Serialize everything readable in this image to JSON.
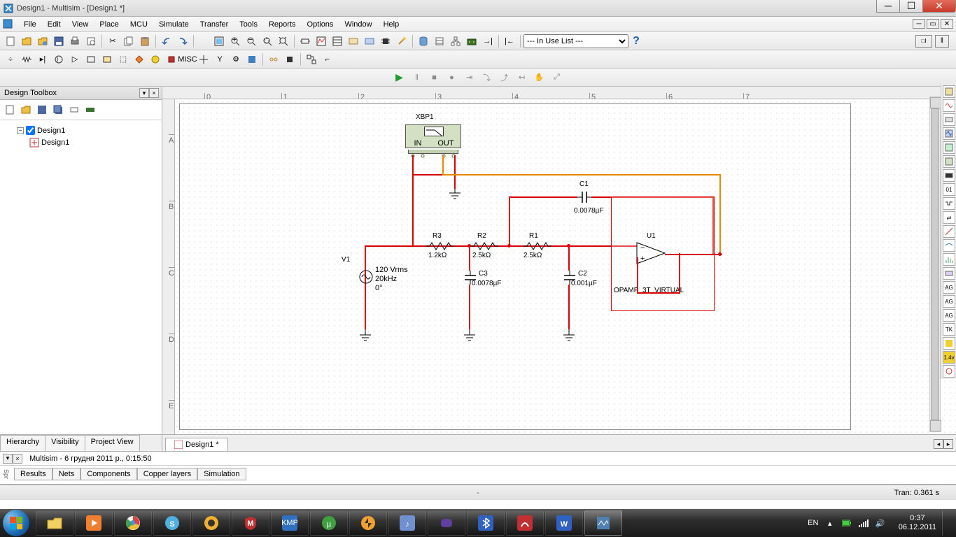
{
  "window": {
    "title": "Design1 - Multisim - [Design1 *]"
  },
  "menubar": [
    "File",
    "Edit",
    "View",
    "Place",
    "MCU",
    "Simulate",
    "Transfer",
    "Tools",
    "Reports",
    "Options",
    "Window",
    "Help"
  ],
  "components_dropdown": "--- In Use List ---",
  "design_toolbox": {
    "title": "Design Toolbox",
    "tree": {
      "root": "Design1",
      "child": "Design1"
    },
    "tabs": [
      "Hierarchy",
      "Visibility",
      "Project View"
    ]
  },
  "canvas": {
    "doc_tab": "Design1 *",
    "ruler_marks": [
      "0",
      "1",
      "2",
      "3",
      "4",
      "5",
      "6",
      "7"
    ],
    "ruler_left": [
      "A",
      "B",
      "C",
      "D",
      "E"
    ],
    "bode": {
      "label": "XBP1",
      "in": "IN",
      "out": "OUT"
    },
    "components": {
      "V1": {
        "label": "V1",
        "v": "120 Vrms",
        "f": "20kHz",
        "phase": "0°"
      },
      "R1": {
        "label": "R1",
        "val": "2.5kΩ"
      },
      "R2": {
        "label": "R2",
        "val": "2.5kΩ"
      },
      "R3": {
        "label": "R3",
        "val": "1.2kΩ"
      },
      "C1": {
        "label": "C1",
        "val": "0.0078µF"
      },
      "C2": {
        "label": "C2",
        "val": "0.001µF"
      },
      "C3": {
        "label": "C3",
        "val": "0.0078µF"
      },
      "U1": {
        "label": "U1",
        "type": "OPAMP_3T_VIRTUAL"
      }
    }
  },
  "spreadsheet": {
    "log": "Multisim  -  6 грудня 2011 р., 0:15:50",
    "tabs": [
      "Results",
      "Nets",
      "Components",
      "Copper layers",
      "Simulation"
    ]
  },
  "statusbar": {
    "tran": "Tran: 0.361 s"
  },
  "taskbar": {
    "lang": "EN",
    "time": "0:37",
    "date": "06.12.2011"
  }
}
